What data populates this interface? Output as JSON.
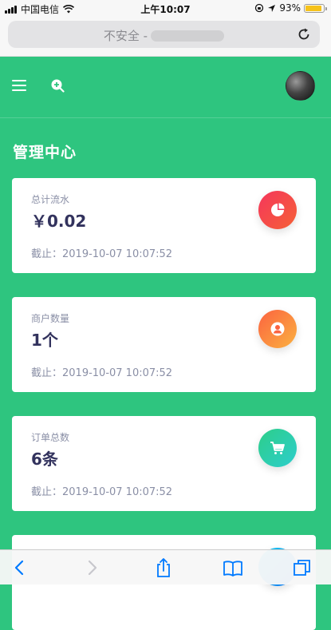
{
  "status_bar": {
    "carrier": "中国电信",
    "time": "上午10:07",
    "battery": "93%",
    "battery_level": 0.93
  },
  "browser": {
    "security_label": "不安全 -"
  },
  "page": {
    "title": "管理中心"
  },
  "cards": [
    {
      "label": "总计流水",
      "value": "￥0.02",
      "date": "截止：2019-10-07 10:07:52",
      "icon": "pie-chart-icon"
    },
    {
      "label": "商户数量",
      "value": "1个",
      "date": "截止：2019-10-07 10:07:52",
      "icon": "user-icon"
    },
    {
      "label": "订单总数",
      "value": "6条",
      "date": "截止：2019-10-07 10:07:52",
      "icon": "cart-icon"
    }
  ],
  "colors": {
    "background": "#2ec57f",
    "card_icon_red": "#f5365c",
    "card_icon_orange": "#fb6340",
    "card_icon_green": "#2dce89",
    "battery": "#f6c21b",
    "link_blue": "#007aff"
  }
}
